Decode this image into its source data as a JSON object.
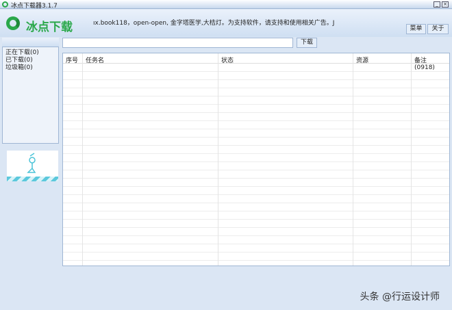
{
  "window": {
    "title": "冰点下载器3.1.7",
    "minimize": "_",
    "close": "×"
  },
  "header": {
    "logo_text": "冰点下载",
    "notice": "ıx.book118，open-open, 金字塔医学,大桔灯。为支持软件，请支持和使用相关广告。J",
    "menu_label": "菜单",
    "about_label": "关于"
  },
  "sidebar": {
    "items": [
      {
        "label": "正在下载(0)"
      },
      {
        "label": "已下载(0)"
      },
      {
        "label": "垃圾箱(0)"
      }
    ]
  },
  "toolbar": {
    "url_value": "",
    "download_label": "下载"
  },
  "table": {
    "columns": [
      "序号",
      "任务名",
      "状态",
      "资源",
      "备注(0918)"
    ]
  },
  "watermark": "头条 @行运设计师"
}
